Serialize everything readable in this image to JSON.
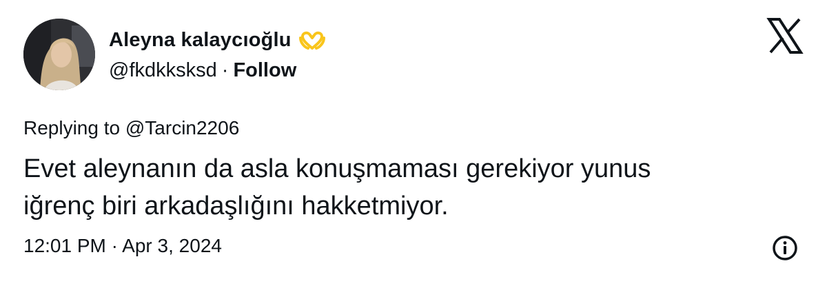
{
  "author": {
    "display_name": "Aleyna kalaycıoğlu",
    "emoji_icon": "heart-hands-icon",
    "handle": "@fkdkksksd",
    "separator": "·",
    "follow_label": "Follow"
  },
  "reply": {
    "prefix": "Replying to ",
    "mention": "@Tarcin2206"
  },
  "tweet": {
    "text": "Evet aleynanın da asla konuşmaması gerekiyor yunus\niğrenç biri arkadaşlığını hakketmiyor."
  },
  "meta": {
    "timestamp": "12:01 PM · Apr 3, 2024"
  },
  "icons": {
    "brand": "x-logo-icon",
    "info": "info-icon"
  },
  "colors": {
    "text": "#0f1419",
    "background": "#ffffff",
    "emoji_yellow": "#f9c51c"
  }
}
